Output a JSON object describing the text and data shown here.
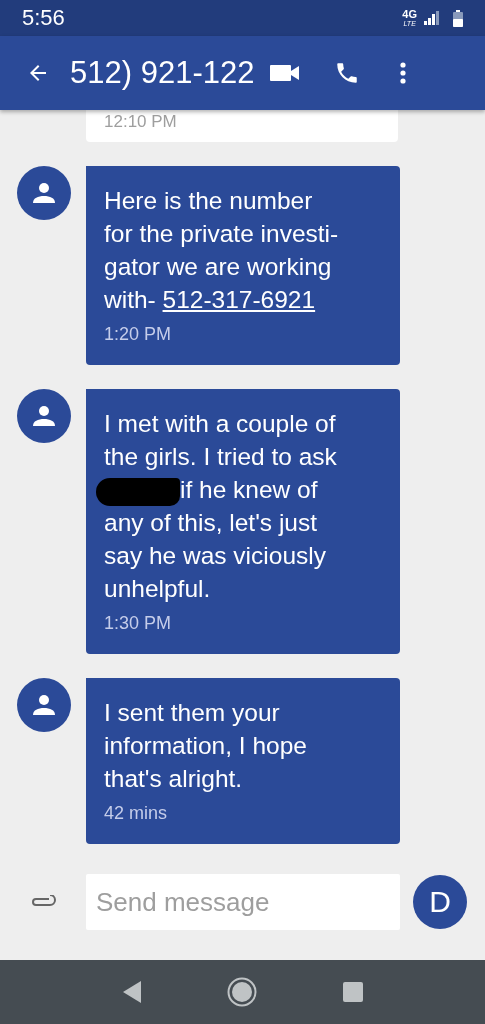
{
  "status_bar": {
    "time": "5:56",
    "network": "4G",
    "network_sub": "LTE"
  },
  "header": {
    "title": "512) 921-122"
  },
  "messages": [
    {
      "kind": "outgoing_partial",
      "time": "12:10 PM"
    },
    {
      "kind": "incoming",
      "segments": [
        {
          "kind": "text",
          "text": "Here is the number\nfor the private investi-\ngator we are working\nwith- "
        },
        {
          "kind": "link",
          "text": "512-317-6921"
        }
      ],
      "time": "1:20 PM"
    },
    {
      "kind": "incoming",
      "segments": [
        {
          "kind": "text",
          "text": "I met with a couple of\nthe girls. I tried to ask\n"
        },
        {
          "kind": "redaction"
        },
        {
          "kind": "text",
          "text": "if he knew of\nany of this, let's just\nsay he was viciously\nunhelpful."
        }
      ],
      "time": "1:30 PM"
    },
    {
      "kind": "incoming",
      "segments": [
        {
          "kind": "text",
          "text": "I sent them your\ninformation, I hope\nthat's alright."
        }
      ],
      "time": "42 mins"
    }
  ],
  "composer": {
    "placeholder": "Send message",
    "send_label": "D"
  }
}
